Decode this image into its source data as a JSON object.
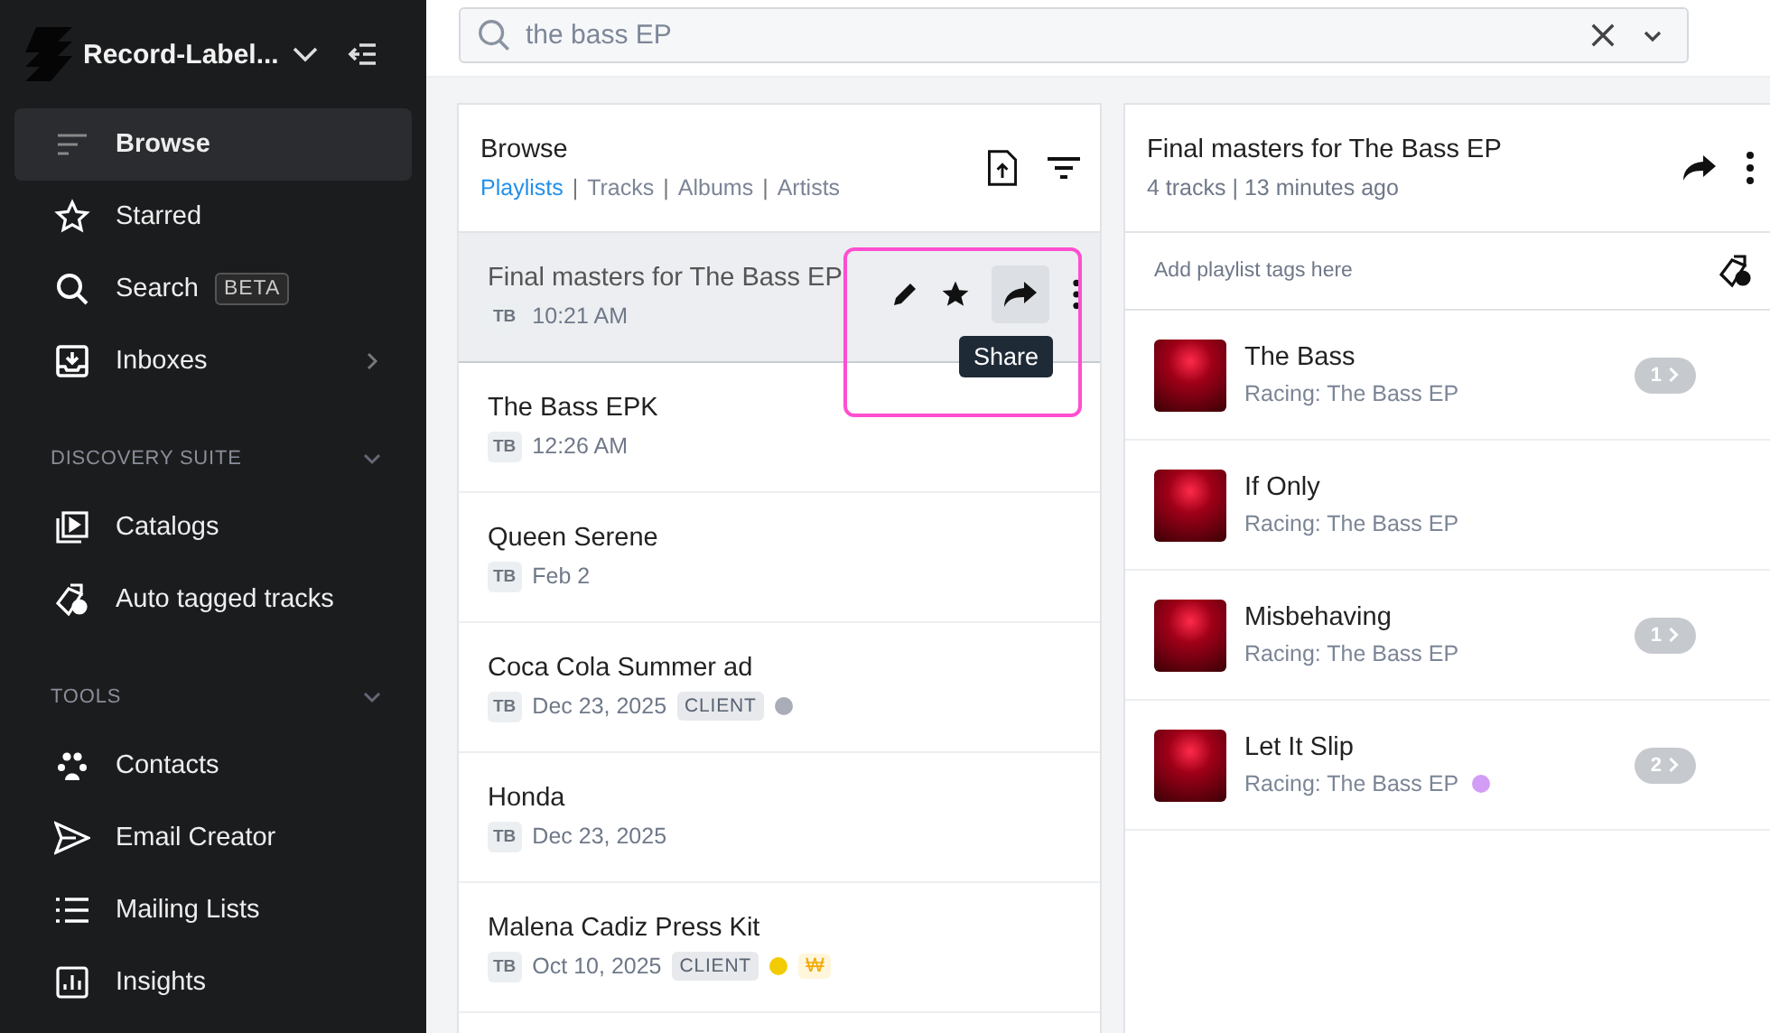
{
  "workspace": {
    "name": "Record-Label..."
  },
  "sidebar": {
    "items": [
      {
        "label": "Browse",
        "kind": "browse",
        "selected": true,
        "submenu": false
      },
      {
        "label": "Starred",
        "kind": "star",
        "selected": false,
        "submenu": false
      },
      {
        "label": "Search",
        "kind": "search",
        "selected": false,
        "submenu": false,
        "badge": "BETA"
      },
      {
        "label": "Inboxes",
        "kind": "inbox",
        "selected": false,
        "submenu": true
      }
    ],
    "sections": [
      {
        "title": "DISCOVERY SUITE",
        "expanded": true,
        "items": [
          {
            "label": "Catalogs",
            "kind": "catalog",
            "selected": false
          },
          {
            "label": "Auto tagged tracks",
            "kind": "autotag",
            "selected": false
          }
        ]
      },
      {
        "title": "TOOLS",
        "expanded": true,
        "items": [
          {
            "label": "Contacts",
            "kind": "contacts",
            "selected": false
          },
          {
            "label": "Email Creator",
            "kind": "send",
            "selected": false
          },
          {
            "label": "Mailing Lists",
            "kind": "list",
            "selected": false
          },
          {
            "label": "Insights",
            "kind": "chart",
            "selected": false
          }
        ]
      }
    ]
  },
  "search": {
    "value": "the bass EP"
  },
  "browse": {
    "title": "Browse",
    "tab_separator": "|",
    "tabs": [
      {
        "label": "Playlists",
        "selected": true
      },
      {
        "label": "Tracks",
        "selected": false
      },
      {
        "label": "Albums",
        "selected": false
      },
      {
        "label": "Artists",
        "selected": false
      }
    ],
    "playlists": [
      {
        "title": "Final masters for The Bass EP",
        "owner": "TB",
        "date": "10:21 AM",
        "selected": true,
        "tooltip": "Share",
        "highlighted": true
      },
      {
        "title": "The Bass EPK",
        "owner": "TB",
        "date": "12:26 AM",
        "selected": false
      },
      {
        "title": "Queen Serene",
        "owner": "TB",
        "date": "Feb 2",
        "selected": false
      },
      {
        "title": "Coca Cola Summer ad",
        "owner": "TB",
        "date": "Dec 23, 2025",
        "selected": false,
        "tag": "CLIENT",
        "color": "#a9adb8"
      },
      {
        "title": "Honda",
        "owner": "TB",
        "date": "Dec 23, 2025",
        "selected": false
      },
      {
        "title": "Malena Cadiz Press Kit",
        "owner": "TB",
        "date": "Oct 10, 2025",
        "selected": false,
        "tag": "CLIENT",
        "color": "#f2cc00",
        "currency": "₩"
      }
    ]
  },
  "playlist": {
    "title": "Final masters for The Bass EP",
    "meta": "4 tracks | 13 minutes ago",
    "tags_placeholder": "Add playlist tags here",
    "tracks": [
      {
        "title": "The Bass",
        "album": "Racing: The Bass EP",
        "count": "1"
      },
      {
        "title": "If Only",
        "album": "Racing: The Bass EP"
      },
      {
        "title": "Misbehaving",
        "album": "Racing: The Bass EP",
        "count": "1"
      },
      {
        "title": "Let It Slip",
        "album": "Racing: The Bass EP",
        "count": "2",
        "color": "#d39cf5"
      }
    ]
  }
}
